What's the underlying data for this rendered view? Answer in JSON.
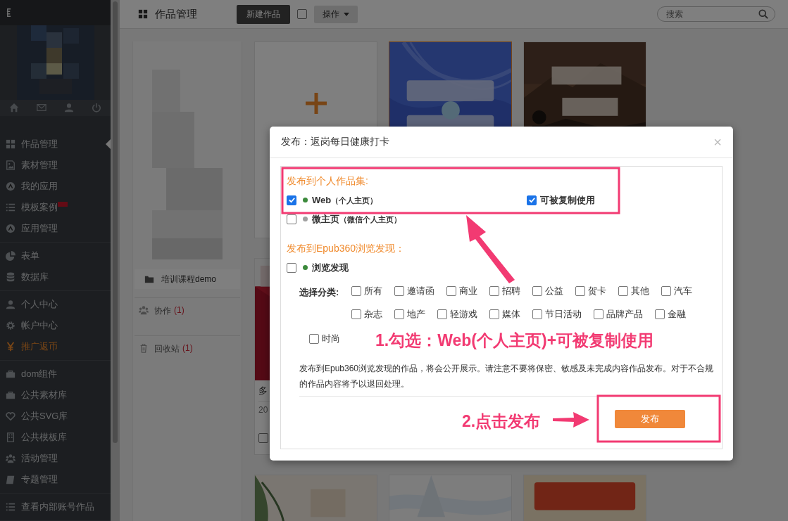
{
  "sidebar": {
    "groups": [
      {
        "items": [
          {
            "label": "作品管理",
            "selected": true,
            "highlighted": false,
            "badge": false
          },
          {
            "label": "素材管理",
            "selected": false,
            "highlighted": false,
            "badge": false
          },
          {
            "label": "我的应用",
            "selected": false,
            "highlighted": false,
            "badge": false
          },
          {
            "label": "模板案例",
            "selected": false,
            "highlighted": false,
            "badge": true
          },
          {
            "label": "应用管理",
            "selected": false,
            "highlighted": false,
            "badge": false
          }
        ]
      },
      {
        "items": [
          {
            "label": "表单",
            "selected": false,
            "highlighted": false,
            "badge": false
          },
          {
            "label": "数据库",
            "selected": false,
            "highlighted": false,
            "badge": false
          }
        ]
      },
      {
        "items": [
          {
            "label": "个人中心",
            "selected": false,
            "highlighted": false,
            "badge": false
          },
          {
            "label": "帐户中心",
            "selected": false,
            "highlighted": false,
            "badge": false
          },
          {
            "label": "推广返币",
            "selected": false,
            "highlighted": true,
            "badge": false
          }
        ]
      },
      {
        "items": [
          {
            "label": "dom组件",
            "selected": false,
            "highlighted": false,
            "badge": false
          },
          {
            "label": "公共素材库",
            "selected": false,
            "highlighted": false,
            "badge": false
          },
          {
            "label": "公共SVG库",
            "selected": false,
            "highlighted": false,
            "badge": false
          },
          {
            "label": "公共模板库",
            "selected": false,
            "highlighted": false,
            "badge": false
          },
          {
            "label": "活动管理",
            "selected": false,
            "highlighted": false,
            "badge": false
          },
          {
            "label": "专题管理",
            "selected": false,
            "highlighted": false,
            "badge": false
          }
        ]
      },
      {
        "items": [
          {
            "label": "查看内部账号作品",
            "selected": false,
            "highlighted": false,
            "badge": false
          }
        ]
      }
    ]
  },
  "toolbar": {
    "title": "作品管理",
    "new_button": "新建作品",
    "select_all": {
      "checked": false
    },
    "action_button": "操作",
    "search": {
      "placeholder": "搜索"
    }
  },
  "folders": [
    {
      "name": "培训课程demo"
    }
  ],
  "links": [
    {
      "label": "协作",
      "count": "(1)"
    },
    {
      "label": "回收站",
      "count": "(1)"
    }
  ],
  "works": [
    [
      {
        "kind": "add",
        "selected": false
      },
      {
        "kind": "picture",
        "selected": true
      },
      {
        "kind": "picture",
        "selected": false
      }
    ],
    [
      {
        "kind": "picture",
        "selected": false,
        "title": "多",
        "date": "20",
        "checked": false
      }
    ],
    [
      {
        "kind": "picture",
        "selected": false
      },
      {
        "kind": "picture",
        "selected": false
      },
      {
        "kind": "picture",
        "selected": false
      }
    ]
  ],
  "dialog": {
    "title": "发布：返岗每日健康打卡",
    "close": "×",
    "personal": {
      "title": "发布到个人作品集:",
      "options": [
        {
          "label": "Web",
          "note": "（个人主页）",
          "checked": true,
          "color": "#3c8a3c",
          "extra": {
            "label": "可被复制使用",
            "checked": true
          }
        },
        {
          "label": "微主页",
          "note": "（微信个人主页）",
          "checked": false,
          "color": "#a0a0a0"
        }
      ]
    },
    "discover": {
      "title": "发布到Epub360浏览发现：",
      "option": {
        "label": "浏览发现",
        "checked": false,
        "color": "#3c8a3c"
      },
      "category_label": "选择分类:",
      "categories": [
        {
          "label": "所有",
          "checked": false
        },
        {
          "label": "邀请函",
          "checked": false
        },
        {
          "label": "商业",
          "checked": false
        },
        {
          "label": "招聘",
          "checked": false
        },
        {
          "label": "公益",
          "checked": false
        },
        {
          "label": "贺卡",
          "checked": false
        },
        {
          "label": "其他",
          "checked": false
        },
        {
          "label": "汽车",
          "checked": false
        },
        {
          "label": "杂志",
          "checked": false
        },
        {
          "label": "地产",
          "checked": false
        },
        {
          "label": "轻游戏",
          "checked": false
        },
        {
          "label": "媒体",
          "checked": false
        },
        {
          "label": "节日活动",
          "checked": false
        },
        {
          "label": "品牌产品",
          "checked": false
        },
        {
          "label": "金融",
          "checked": false
        },
        {
          "label": "时尚",
          "checked": false
        }
      ]
    },
    "notice": "发布到Epub360浏览发现的作品，将会公开展示。请注意不要将保密、敏感及未完成内容作品发布。对于不合规的作品内容将予以退回处理。",
    "publish_button": "发布"
  },
  "annotations": [
    {
      "text": "1.勾选：Web(个人主页)+可被复制使用"
    },
    {
      "text": "2.点击发布"
    }
  ]
}
